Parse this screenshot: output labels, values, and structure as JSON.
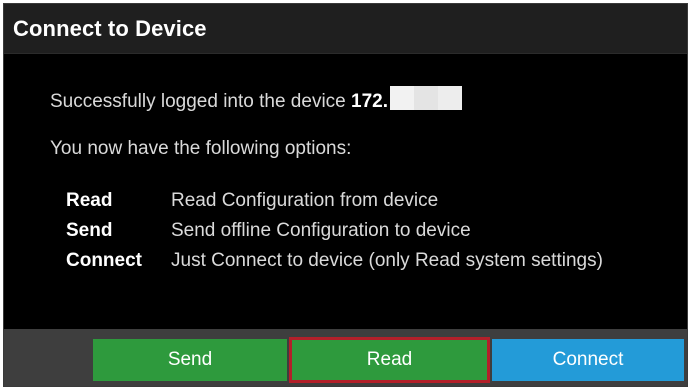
{
  "dialog": {
    "title": "Connect to Device",
    "login_text": "Successfully logged into the device ",
    "ip_prefix": "172.",
    "options_intro": "You now have the following options:",
    "options": [
      {
        "key": "Read",
        "description": "Read Configuration from device"
      },
      {
        "key": "Send",
        "description": "Send offline Configuration to device"
      },
      {
        "key": "Connect",
        "description": "Just Connect to device (only Read system settings)"
      }
    ]
  },
  "buttons": {
    "send_label": "Send",
    "read_label": "Read",
    "connect_label": "Connect"
  },
  "colors": {
    "send_button": "#2e9a3d",
    "read_button": "#2e9a3d",
    "read_highlight_border": "#b3202a",
    "connect_button": "#239bd8",
    "footer": "#3e3e3e",
    "title_bar": "#1f1f1f",
    "background": "#000000"
  }
}
